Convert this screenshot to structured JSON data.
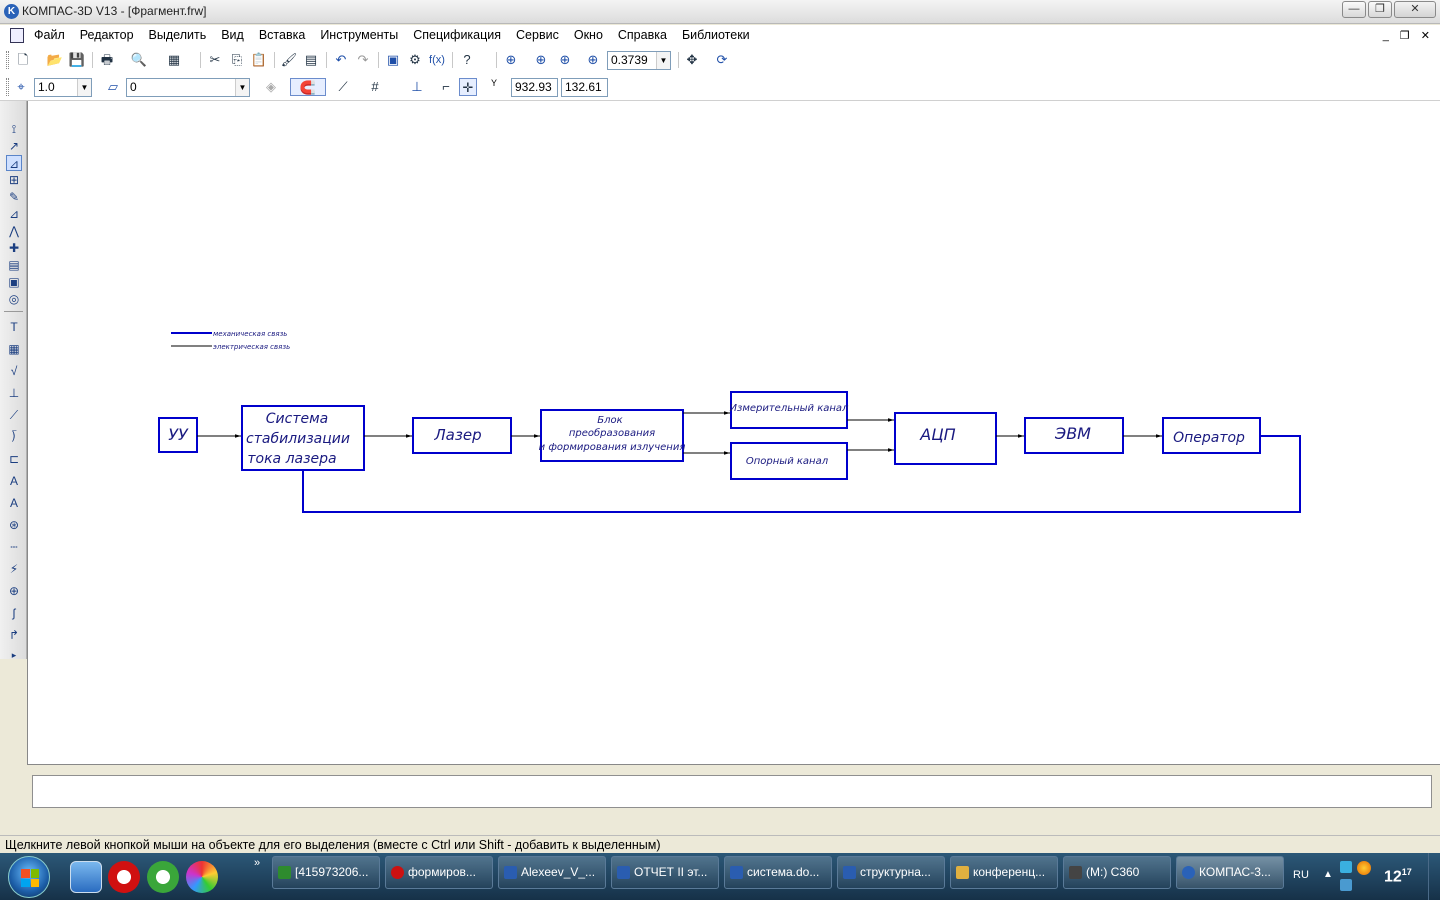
{
  "window": {
    "title": "КОМПАС-3D V13 - [Фрагмент.frw]",
    "app_icon": "kompas-icon"
  },
  "menu": {
    "items": [
      "Файл",
      "Редактор",
      "Выделить",
      "Вид",
      "Вставка",
      "Инструменты",
      "Спецификация",
      "Сервис",
      "Окно",
      "Справка",
      "Библиотеки"
    ]
  },
  "toolbar1": {
    "zoom_value": "0.3739"
  },
  "toolbar2": {
    "step_value": "1.0",
    "layer_value": "0",
    "coord_label": "Y",
    "coord_x": "932.93",
    "coord_y": "132.61"
  },
  "diagram": {
    "legend": [
      {
        "label": "механическая связь",
        "color": "#0000cc"
      },
      {
        "label": "электрическая связь",
        "color": "#000000"
      }
    ],
    "blocks": {
      "uu": "УУ",
      "stab_1": "Система",
      "stab_2": "стабилизации",
      "stab_3": "тока лазера",
      "laser": "Лазер",
      "conv_1": "Блок",
      "conv_2": "преобразования",
      "conv_3": "и формирования излучения",
      "meas": "Измерительный канал",
      "ref": "Опорный канал",
      "adc": "АЦП",
      "pc": "ЭВМ",
      "operator": "Оператор"
    },
    "colors": {
      "block": "#0000cc",
      "link": "#000000"
    }
  },
  "status": {
    "text": "Щелкните левой кнопкой мыши на объекте для его выделения (вместе с Ctrl или Shift - добавить к выделенным)"
  },
  "taskbar": {
    "tasks": [
      {
        "label": "[415973206...",
        "icon": "spreadsheet-icon",
        "color": "#2e8b2e"
      },
      {
        "label": "формиров...",
        "icon": "opera-icon",
        "color": "#cc1111"
      },
      {
        "label": "Alexeev_V_...",
        "icon": "word-icon",
        "color": "#2a5db0"
      },
      {
        "label": "ОТЧЕТ II эт...",
        "icon": "word-icon",
        "color": "#2a5db0"
      },
      {
        "label": "система.do...",
        "icon": "word-icon",
        "color": "#2a5db0"
      },
      {
        "label": "структурна...",
        "icon": "word-icon",
        "color": "#2a5db0"
      },
      {
        "label": "конференц...",
        "icon": "folder-icon",
        "color": "#e0b040"
      },
      {
        "label": "(M:) C360",
        "icon": "drive-icon",
        "color": "#444"
      },
      {
        "label": "КОМПАС-3...",
        "icon": "kompas-icon",
        "color": "#2a62b8"
      }
    ],
    "language": "RU",
    "clock_hour": "12",
    "clock_min": "17"
  }
}
